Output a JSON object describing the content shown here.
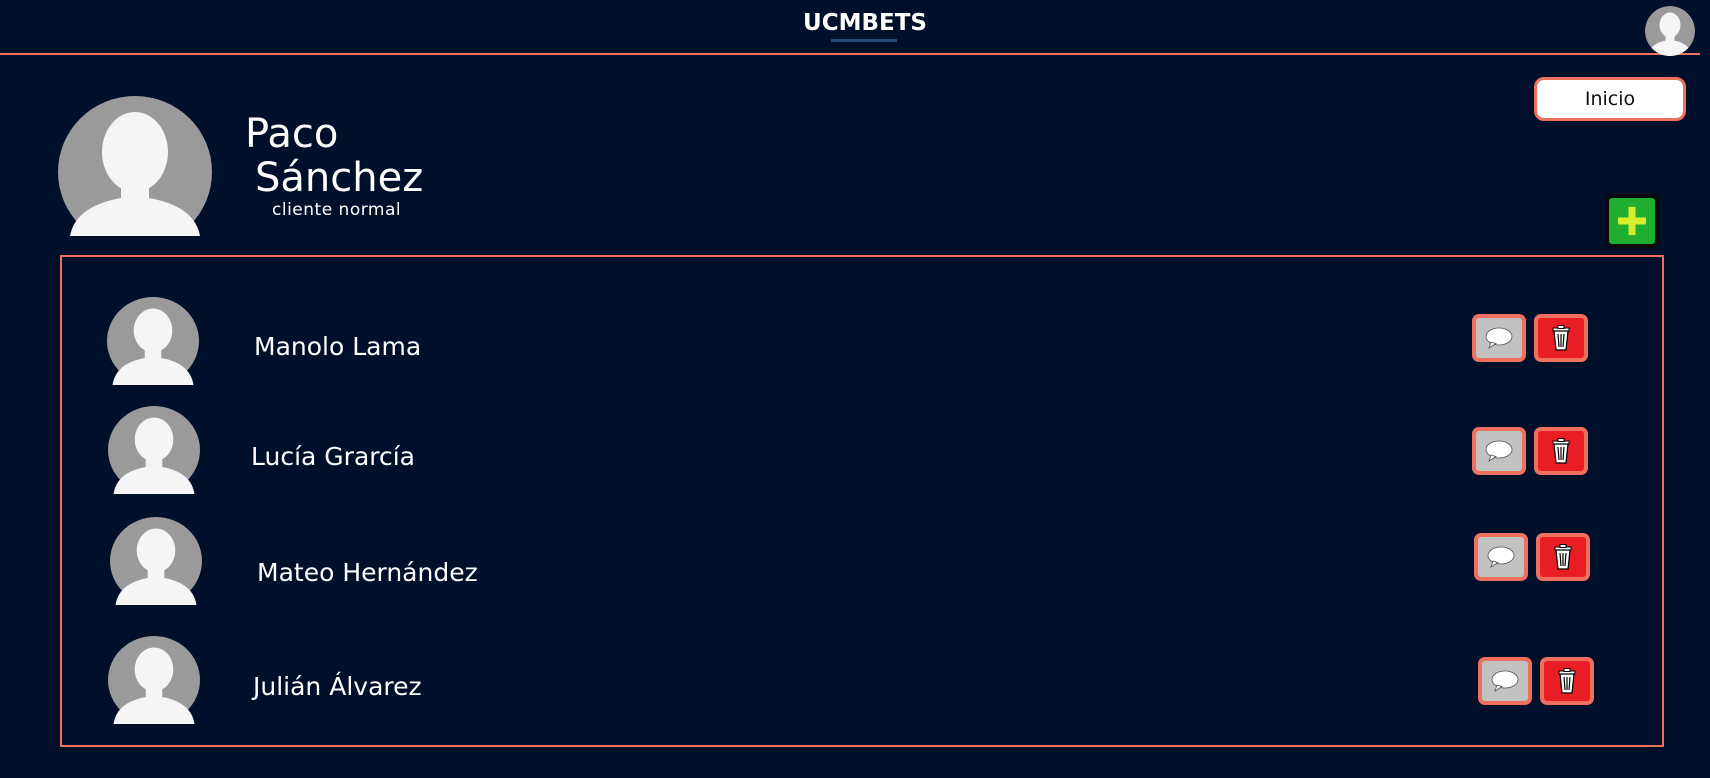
{
  "header": {
    "logo": "UCMBETS",
    "avatar_icon": "user-avatar-icon"
  },
  "nav": {
    "inicio_label": "Inicio"
  },
  "profile": {
    "first_name": "Paco",
    "last_name": "Sánchez",
    "role": "cliente normal"
  },
  "actions": {
    "add_icon": "plus-icon"
  },
  "friends": [
    {
      "name": "Manolo Lama"
    },
    {
      "name": "Lucía Grarcía"
    },
    {
      "name": "Mateo Hernández"
    },
    {
      "name": "Julián Álvarez"
    }
  ],
  "colors": {
    "background": "#01102a",
    "accent": "#f0705f",
    "add_green": "#1fae2f",
    "delete_red": "#e81e24",
    "chat_gray": "#c2c2c2"
  }
}
